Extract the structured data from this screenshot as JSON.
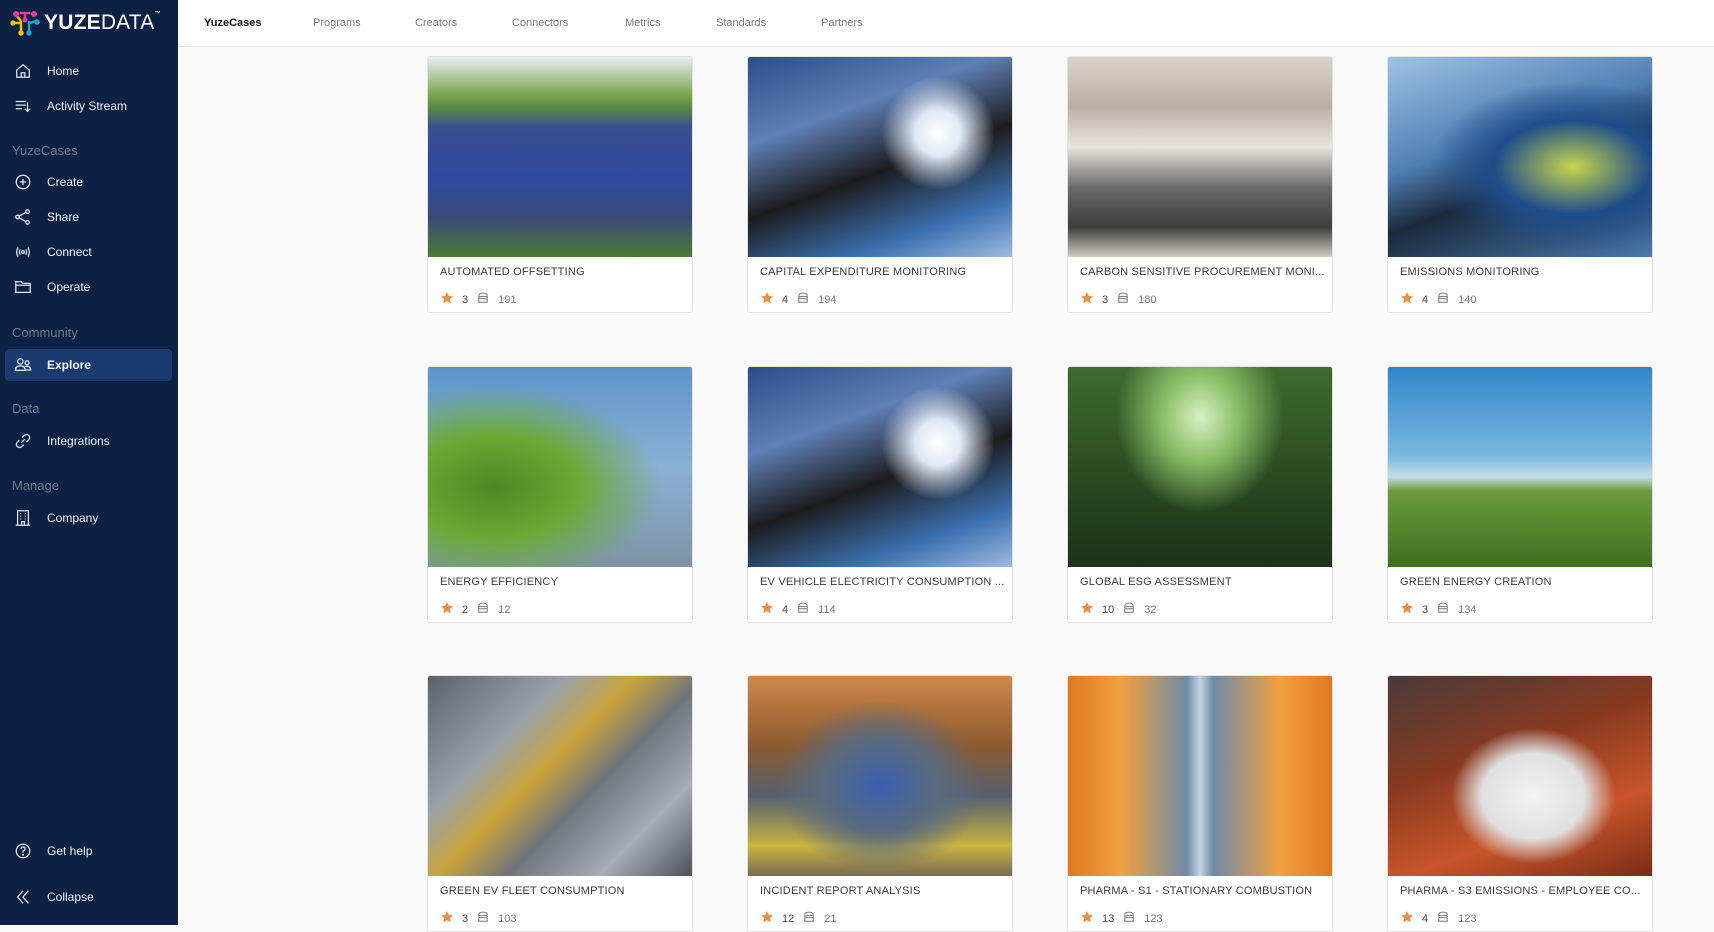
{
  "brand": {
    "name_bold": "YUZE",
    "name_light": "DATA",
    "tm": "™"
  },
  "sidebar": {
    "top_items": [
      {
        "label": "Home",
        "icon": "home-icon"
      },
      {
        "label": "Activity Stream",
        "icon": "activity-stream-icon"
      }
    ],
    "sections": [
      {
        "title": "YuzeCases",
        "items": [
          {
            "label": "Create",
            "icon": "plus-circle-icon"
          },
          {
            "label": "Share",
            "icon": "share-icon"
          },
          {
            "label": "Connect",
            "icon": "broadcast-icon"
          },
          {
            "label": "Operate",
            "icon": "folder-icon"
          }
        ]
      },
      {
        "title": "Community",
        "items": [
          {
            "label": "Explore",
            "icon": "users-icon",
            "active": true
          }
        ]
      },
      {
        "title": "Data",
        "items": [
          {
            "label": "Integrations",
            "icon": "link-icon"
          }
        ]
      },
      {
        "title": "Manage",
        "items": [
          {
            "label": "Company",
            "icon": "building-icon"
          }
        ]
      }
    ],
    "bottom_items": [
      {
        "label": "Get help",
        "icon": "help-icon"
      },
      {
        "label": "Collapse",
        "icon": "chevrons-left-icon"
      }
    ]
  },
  "tabs": [
    {
      "label": "YuzeCases",
      "active": true
    },
    {
      "label": "Programs"
    },
    {
      "label": "Creators"
    },
    {
      "label": "Connectors"
    },
    {
      "label": "Metrics"
    },
    {
      "label": "Standards"
    },
    {
      "label": "Partners"
    }
  ],
  "colors": {
    "sidebar_bg": "#0c2143",
    "active_bg": "#1a3a70",
    "star": "#f58a3c"
  },
  "cards": [
    {
      "title": "AUTOMATED OFFSETTING",
      "stars": "3",
      "uses": "191",
      "image": "solar-panels-field"
    },
    {
      "title": "CAPITAL EXPENDITURE MONITORING",
      "stars": "4",
      "uses": "194",
      "image": "ev-charger-solar"
    },
    {
      "title": "CARBON SENSITIVE PROCUREMENT MONI...",
      "stars": "3",
      "uses": "180",
      "image": "laptop-desk"
    },
    {
      "title": "EMISSIONS MONITORING",
      "stars": "4",
      "uses": "140",
      "image": "worker-tablet"
    },
    {
      "title": "ENERGY EFFICIENCY",
      "stars": "2",
      "uses": "12",
      "image": "tree-building"
    },
    {
      "title": "EV VEHICLE ELECTRICITY CONSUMPTION ...",
      "stars": "4",
      "uses": "114",
      "image": "ev-charger-solar"
    },
    {
      "title": "GLOBAL ESG ASSESSMENT",
      "stars": "10",
      "uses": "32",
      "image": "forest"
    },
    {
      "title": "GREEN ENERGY CREATION",
      "stars": "3",
      "uses": "134",
      "image": "wind-turbines"
    },
    {
      "title": "GREEN EV FLEET CONSUMPTION",
      "stars": "3",
      "uses": "103",
      "image": "robot-assembly-line"
    },
    {
      "title": "INCIDENT REPORT ANALYSIS",
      "stars": "12",
      "uses": "21",
      "image": "first-aid"
    },
    {
      "title": "PHARMA - S1 - STATIONARY COMBUSTION",
      "stars": "13",
      "uses": "123",
      "image": "orange-robots"
    },
    {
      "title": "PHARMA - S3 EMISSIONS - EMPLOYEE CO...",
      "stars": "4",
      "uses": "123",
      "image": "hard-hat-car"
    }
  ]
}
